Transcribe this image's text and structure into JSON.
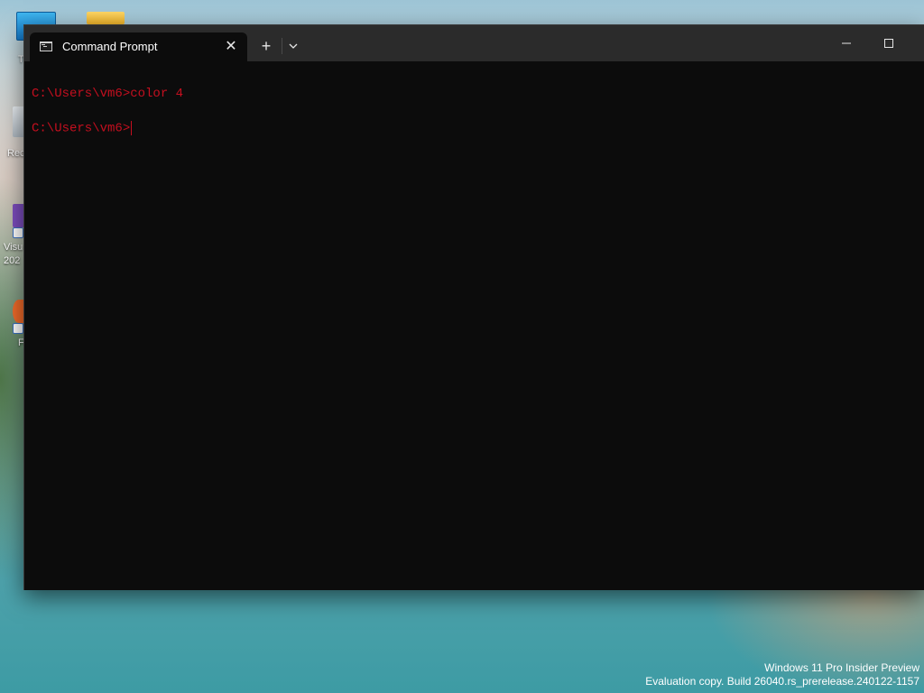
{
  "desktop": {
    "icons": [
      {
        "label": "T",
        "icon": "this-pc-icon"
      },
      {
        "label": "",
        "icon": "folder-icon"
      },
      {
        "label": "Rec",
        "icon": "recycle-bin-icon"
      },
      {
        "label": "Visu",
        "label2": "202",
        "icon": "visual-studio-icon"
      },
      {
        "label": "F",
        "icon": "firefox-icon"
      }
    ]
  },
  "terminal": {
    "tab_title": "Command Prompt",
    "tab_close": "✕",
    "new_tab": "+",
    "lines": [
      "C:\\Users\\vm6>color 4",
      "C:\\Users\\vm6>"
    ],
    "text_color": "#c50f1f",
    "background": "#0c0c0c"
  },
  "watermark": {
    "line1": "Windows 11 Pro Insider Preview",
    "line2": "Evaluation copy. Build 26040.rs_prerelease.240122-1157"
  }
}
